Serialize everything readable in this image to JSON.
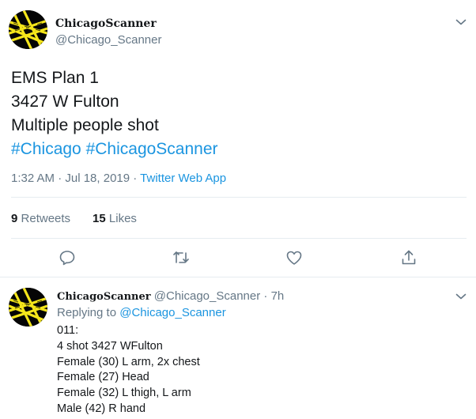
{
  "tweet": {
    "display_name": "ChicagoScanner",
    "handle": "@Chicago_Scanner",
    "lines": [
      "EMS Plan 1",
      "3427 W Fulton",
      "Multiple people shot"
    ],
    "hashtags": [
      "#Chicago",
      "#ChicagoScanner"
    ],
    "timestamp": "1:32 AM · Jul 18, 2019",
    "separator": " · ",
    "source": "Twitter Web App",
    "retweets_count": "9",
    "retweets_label": "Retweets",
    "likes_count": "15",
    "likes_label": "Likes"
  },
  "actions": {
    "reply_icon": "reply-bubble",
    "retweet_icon": "retweet-arrows",
    "like_icon": "heart",
    "share_icon": "share-upload"
  },
  "reply": {
    "display_name": "ChicagoScanner",
    "handle": "@Chicago_Scanner",
    "time": "· 7h",
    "replying_label": "Replying to",
    "replying_to": "@Chicago_Scanner",
    "lines": [
      "011:",
      "4 shot 3427 WFulton",
      "Female (30) L arm, 2x chest",
      "Female (27) Head",
      "Female (32) L thigh, L arm",
      "Male (42) R hand"
    ]
  },
  "colors": {
    "link": "#1b95e0",
    "secondary_text": "#657786",
    "divider": "#e6ecf0",
    "avatar_tape": "#f5e61b"
  }
}
